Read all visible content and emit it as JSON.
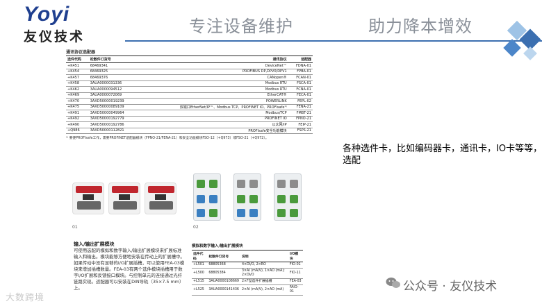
{
  "brand": {
    "logo_en": "Yoyi",
    "logo_cn": "友仪技术"
  },
  "header": {
    "slogan_left": "专注设备维护",
    "slogan_right": "助力降本增效"
  },
  "doc": {
    "table_title": "通讯协议选配器",
    "columns": [
      "选件代码",
      "松散件订货号",
      "通讯协议",
      "适配器"
    ],
    "rows": [
      [
        "+K451",
        "68469341",
        "DeviceNet™",
        "FDNA-01"
      ],
      [
        "+K454",
        "68469325",
        "PROFIBUS DP,DPV0/DPV1",
        "FPBA-01"
      ],
      [
        "+K457",
        "68469376",
        "CANopen®",
        "FCAN-01"
      ],
      [
        "+K458",
        "3AUA0000031336",
        "Modbus RTU",
        "FSCA-01"
      ],
      [
        "+K462",
        "3AUA0000094512",
        "Modbus RTU",
        "FCNA-01"
      ],
      [
        "+K469",
        "3AUA0000072069",
        "EtherCAT®",
        "FECA-01"
      ],
      [
        "+K470",
        "3AXD50000019239",
        "POWERLINK",
        "FEPL-02"
      ],
      [
        "+K475",
        "3AXD50000089109",
        "双端口EtherNet/IP™、Modbus TCP、PROFINET IO、PROFIsafe¹⁾",
        "FENA-21"
      ],
      [
        "+K491",
        "3AXD50000049964",
        "Modbus/TCP",
        "FMBT-21"
      ],
      [
        "+K492",
        "3AXD50000192779",
        "PROFINET IO",
        "FPNO-21"
      ],
      [
        "+K490",
        "3AXD50000192786",
        "以太网/IP",
        "FEIP-21"
      ],
      [
        "+Q986",
        "3AXD50000112821",
        "PROFIsafe安全功能模块",
        "FSPS-21"
      ]
    ],
    "footnote": "¹⁾ 要使PROFIsafe工作，需要PROFINET适配器模块（FPNO-21/FENA-21）和安全功能模块FSO-12（+Q973）或FSO-21（+Q972）。",
    "caption_01": "01",
    "caption_02": "02",
    "section_title": "输入/输出扩展模块",
    "section_body": "可使用选配的模拟和数字输入/输出扩展模块来扩展标准输入和输出。模块能够方便地安装在传动上的扩展槽中。\n如果传动中没有足够的I/O扩展插槽，可以使用FEA-03模块来增加插槽数量。FEA-03有两个选件模块插槽用于数字I/O扩展和反馈接口模块。与控制单元的连接通过光纤链路实现。适配器可以安装在DIN导轨（35×7.5 mm）上。",
    "io_table_title": "模拟和数字输入/输出扩展模块",
    "io_columns": [
      "选件代码",
      "松散件订货号",
      "说明",
      "I/O模块"
    ],
    "io_rows": [
      [
        "+L501",
        "68805368",
        "4×DI/O, 2×RO",
        "FIO-01"
      ],
      [
        "+L500",
        "68805384",
        "3×AI (mA/V), 1×AO (mA); 2×DI/O",
        "FIO-11"
      ],
      [
        "+L515",
        "3AUA0000108669",
        "2×F型选件扩展插槽",
        "FEA-03"
      ],
      [
        "+L525",
        "3AUA0000141436",
        "2×AI (mA/V), 2×AO (mA)",
        "FAIO-01"
      ]
    ]
  },
  "annotation": "各种选件卡，比如编码器卡，通讯卡，IO卡等等，选配",
  "watermark_left": "大数跨境",
  "watermark_right": "公众号 · 友仪技术",
  "colors": {
    "brand_blue": "#1f3f8f",
    "deco_blue": "#3b6fb0",
    "slogan_gray": "#8a9099"
  }
}
